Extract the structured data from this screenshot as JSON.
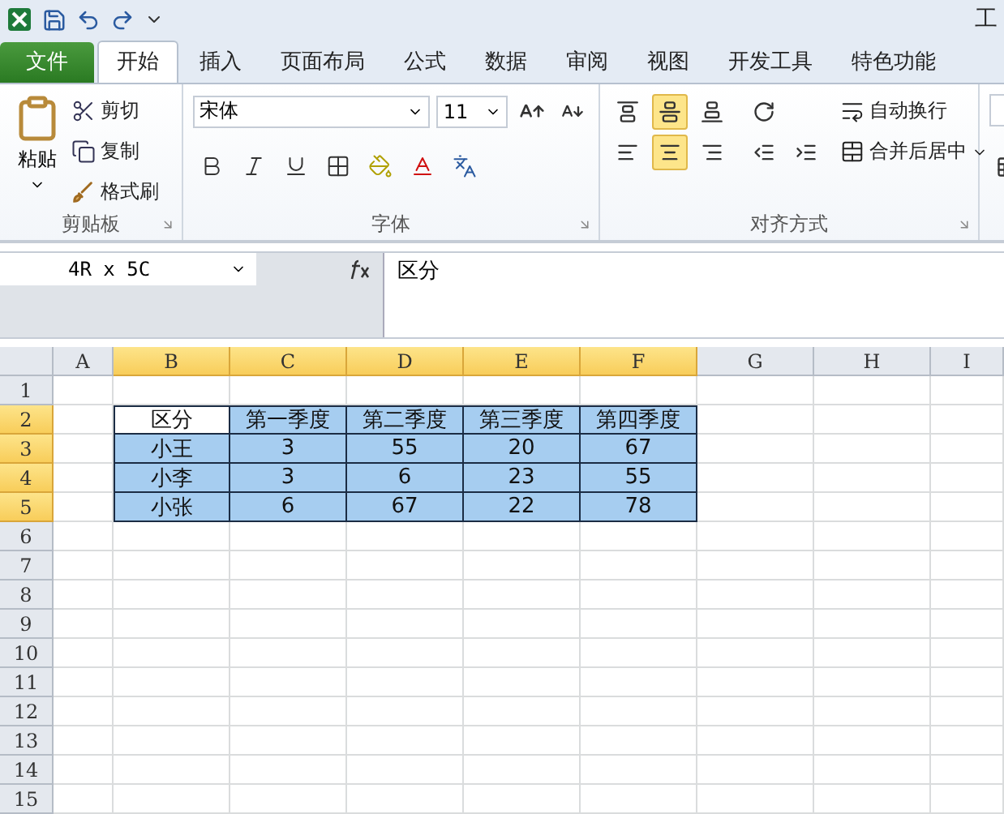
{
  "title_bar": {
    "title_fragment": "工"
  },
  "tabs": [
    {
      "label": "文件",
      "kind": "file",
      "selected": false
    },
    {
      "label": "开始",
      "kind": "normal",
      "selected": true
    },
    {
      "label": "插入",
      "kind": "normal",
      "selected": false
    },
    {
      "label": "页面布局",
      "kind": "normal",
      "selected": false
    },
    {
      "label": "公式",
      "kind": "normal",
      "selected": false
    },
    {
      "label": "数据",
      "kind": "normal",
      "selected": false
    },
    {
      "label": "审阅",
      "kind": "normal",
      "selected": false
    },
    {
      "label": "视图",
      "kind": "normal",
      "selected": false
    },
    {
      "label": "开发工具",
      "kind": "normal",
      "selected": false
    },
    {
      "label": "特色功能",
      "kind": "normal",
      "selected": false
    }
  ],
  "ribbon": {
    "clipboard": {
      "paste": "粘贴",
      "cut": "剪切",
      "copy": "复制",
      "format_painter": "格式刷",
      "title": "剪贴板"
    },
    "font": {
      "font_name": "宋体",
      "font_size": "11",
      "title": "字体"
    },
    "alignment": {
      "vertical_buttons": [
        {
          "selected": false
        },
        {
          "selected": true
        },
        {
          "selected": false
        }
      ],
      "horizontal_buttons": [
        {
          "selected": false
        },
        {
          "selected": true
        },
        {
          "selected": false
        }
      ],
      "wrap_text": "自动换行",
      "merge_center": "合并后居中",
      "title": "对齐方式"
    }
  },
  "formula_bar": {
    "name_box": "4R x 5C",
    "value": "区分"
  },
  "sheet": {
    "columns": [
      {
        "label": "A",
        "selected": false
      },
      {
        "label": "B",
        "selected": true
      },
      {
        "label": "C",
        "selected": true
      },
      {
        "label": "D",
        "selected": true
      },
      {
        "label": "E",
        "selected": true
      },
      {
        "label": "F",
        "selected": true
      },
      {
        "label": "G",
        "selected": false
      },
      {
        "label": "H",
        "selected": false
      },
      {
        "label": "I",
        "selected": false
      }
    ],
    "rows": [
      {
        "label": "1",
        "selected": false
      },
      {
        "label": "2",
        "selected": true
      },
      {
        "label": "3",
        "selected": true
      },
      {
        "label": "4",
        "selected": true
      },
      {
        "label": "5",
        "selected": true
      },
      {
        "label": "6",
        "selected": false
      },
      {
        "label": "7",
        "selected": false
      },
      {
        "label": "8",
        "selected": false
      },
      {
        "label": "9",
        "selected": false
      },
      {
        "label": "10",
        "selected": false
      },
      {
        "label": "11",
        "selected": false
      },
      {
        "label": "12",
        "selected": false
      },
      {
        "label": "13",
        "selected": false
      },
      {
        "label": "14",
        "selected": false
      },
      {
        "label": "15",
        "selected": false
      }
    ],
    "table": {
      "header": [
        {
          "text": "区分",
          "active": true
        },
        {
          "text": "第一季度",
          "active": false
        },
        {
          "text": "第二季度",
          "active": false
        },
        {
          "text": "第三季度",
          "active": false
        },
        {
          "text": "第四季度",
          "active": false
        }
      ],
      "rows": [
        [
          "小王",
          "3",
          "55",
          "20",
          "67"
        ],
        [
          "小李",
          "3",
          "6",
          "23",
          "55"
        ],
        [
          "小张",
          "6",
          "67",
          "22",
          "78"
        ]
      ]
    }
  }
}
